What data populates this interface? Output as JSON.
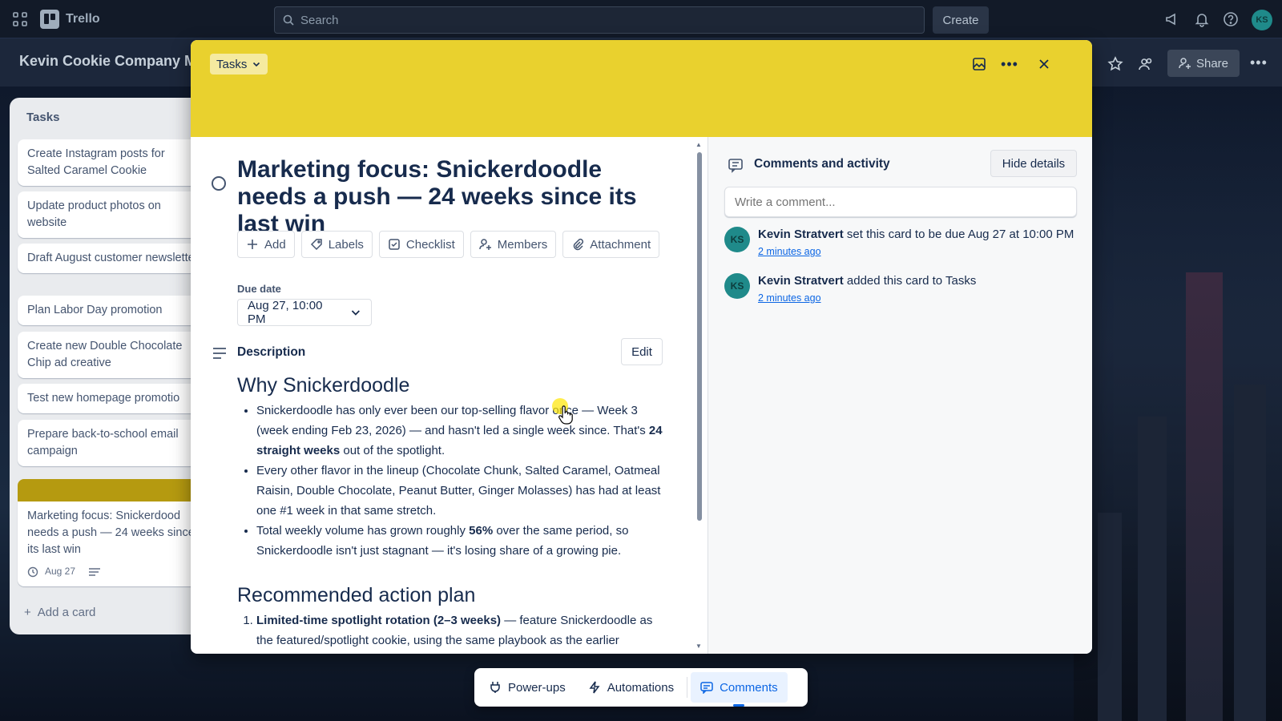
{
  "topnav": {
    "app_name": "Trello",
    "search_placeholder": "Search",
    "create_label": "Create",
    "avatar_initials": "KS"
  },
  "board": {
    "title": "Kevin Cookie Company Ma",
    "share_label": "Share"
  },
  "list": {
    "title": "Tasks",
    "cards": [
      "Create Instagram posts for Salted Caramel Cookie",
      "Update product photos on website",
      "Draft August customer newsletter",
      "Plan Labor Day promotion",
      "Create new Double Chocolate Chip ad creative",
      "Test new homepage promotio",
      "Prepare back-to-school email campaign",
      "Marketing focus: Snickerdood needs a push — 24 weeks since its last win"
    ],
    "active_card_due": "Aug 27",
    "add_card_label": "Add a card"
  },
  "modal": {
    "list_name": "Tasks",
    "cover_color": "#e9d12e",
    "title": "Marketing focus: Snickerdoodle needs a push — 24 weeks since its last win",
    "actions": [
      "Add",
      "Labels",
      "Checklist",
      "Members",
      "Attachment"
    ],
    "due_label": "Due date",
    "due_value": "Aug 27, 10:00 PM",
    "description_label": "Description",
    "edit_label": "Edit",
    "description": {
      "heading1": "Why Snickerdoodle",
      "bullets": [
        {
          "pre": "Snickerdoodle has only ever been our top-selling flavor once — Week 3 (week ending Feb 23, 2026) — and hasn't led a single week since. That's ",
          "bold": "24 straight weeks",
          "post": " out of the spotlight."
        },
        {
          "pre": "Every other flavor in the lineup (Chocolate Chunk, Salted Caramel, Oatmeal Raisin, Double Chocolate, Peanut Butter, Ginger Molasses) has had at least one #1 week in that same stretch.",
          "bold": "",
          "post": ""
        },
        {
          "pre": "Total weekly volume has grown roughly ",
          "bold": "56%",
          "post": " over the same period, so Snickerdoodle isn't just stagnant — it's losing share of a growing pie."
        }
      ],
      "heading2": "Recommended action plan",
      "plan": [
        {
          "bold": "Limited-time spotlight rotation (2–3 weeks)",
          "post": " — feature Snickerdoodle as the featured/spotlight cookie, using the same playbook as the earlier"
        }
      ]
    }
  },
  "activity": {
    "title": "Comments and activity",
    "hide_label": "Hide details",
    "comment_placeholder": "Write a comment...",
    "items": [
      {
        "initials": "KS",
        "user": "Kevin Stratvert",
        "text": " set this card to be due Aug 27 at 10:00 PM",
        "time": "2 minutes ago"
      },
      {
        "initials": "KS",
        "user": "Kevin Stratvert",
        "text": " added this card to Tasks",
        "time": "2 minutes ago"
      }
    ]
  },
  "dock": {
    "powerups": "Power-ups",
    "automations": "Automations",
    "comments": "Comments"
  }
}
